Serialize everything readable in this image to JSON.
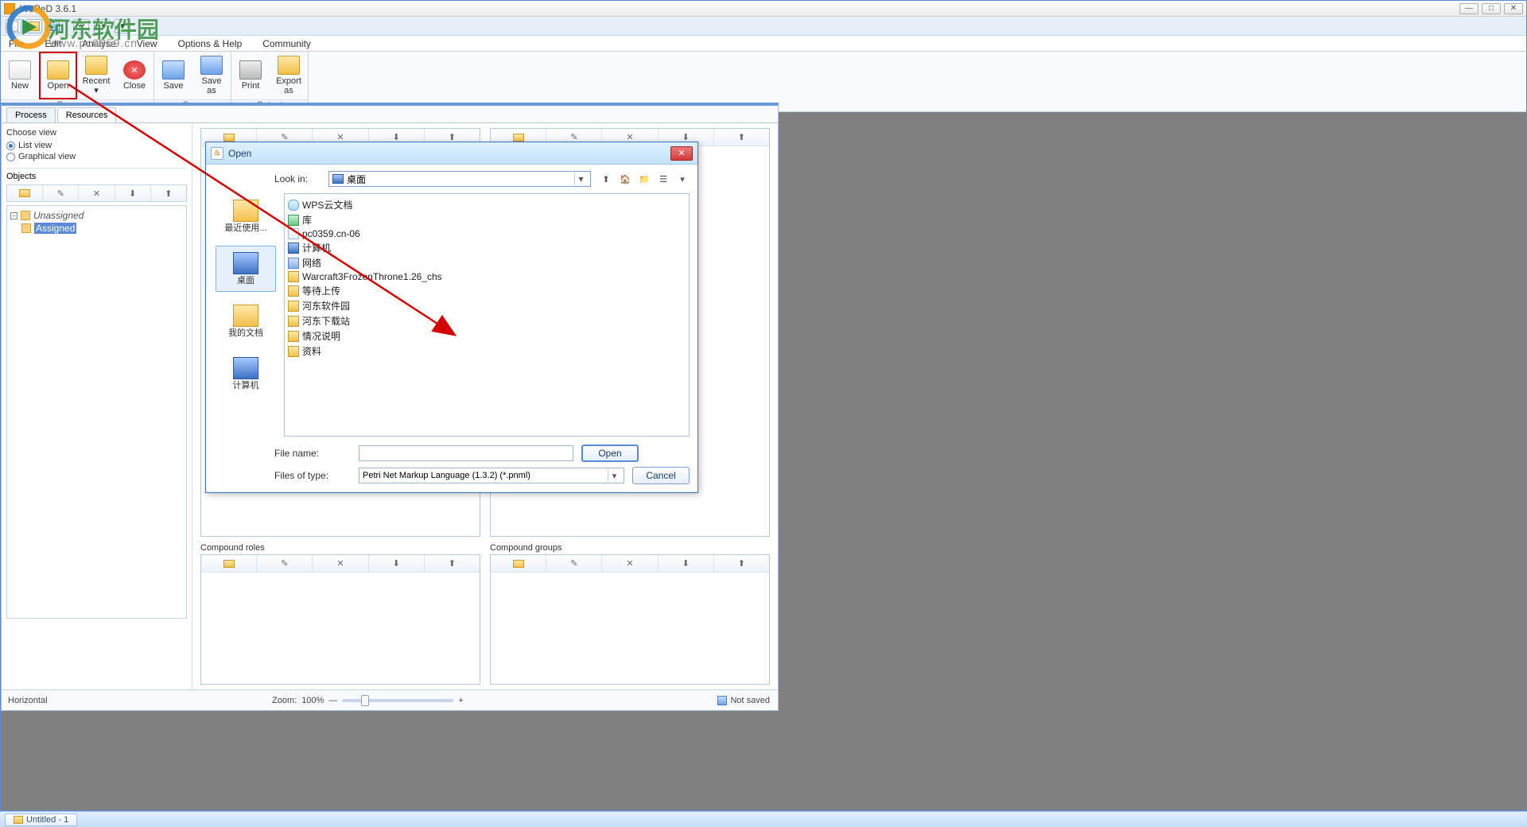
{
  "app": {
    "title": "WoPeD 3.6.1"
  },
  "menu": {
    "file": "File",
    "edit": "Edit",
    "analyse": "Analyse",
    "view": "View",
    "options": "Options & Help",
    "community": "Community"
  },
  "ribbon": {
    "document": {
      "label": "Document",
      "new": "New",
      "open": "Open",
      "recent": "Recent\n▾",
      "close": "Close"
    },
    "save": {
      "label": "Save",
      "save": "Save",
      "saveas": "Save\nas"
    },
    "output": {
      "label": "Output",
      "print": "Print",
      "export": "Export\nas"
    }
  },
  "tabs": {
    "process": "Process",
    "resources": "Resources"
  },
  "chooseview": {
    "title": "Choose view",
    "list": "List view",
    "graphical": "Graphical view"
  },
  "objects": {
    "title": "Objects",
    "unassigned": "Unassigned",
    "assigned": "Assigned"
  },
  "compound": {
    "roles": "Compound roles",
    "groups": "Compound groups"
  },
  "status": {
    "horizontal": "Horizontal",
    "zoomlabel": "Zoom:",
    "zoomval": "100%",
    "notsaved": "Not saved"
  },
  "dialog": {
    "title": "Open",
    "lookin": "Look in:",
    "lookin_val": "桌面",
    "places": {
      "recent": "最近使用...",
      "desktop": "桌面",
      "mydocs": "我的文档",
      "computer": "计算机"
    },
    "files": [
      {
        "icon": "cloud",
        "name": "WPS云文档"
      },
      {
        "icon": "lib",
        "name": "库"
      },
      {
        "icon": "doc",
        "name": "pc0359.cn-06"
      },
      {
        "icon": "monitor",
        "name": "计算机"
      },
      {
        "icon": "net",
        "name": "网络"
      },
      {
        "icon": "folder",
        "name": "Warcraft3FrozenThrone1.26_chs"
      },
      {
        "icon": "folder",
        "name": "等待上传"
      },
      {
        "icon": "folder",
        "name": "河东软件园"
      },
      {
        "icon": "folder",
        "name": "河东下载站"
      },
      {
        "icon": "folder",
        "name": "情况说明"
      },
      {
        "icon": "folder",
        "name": "资料"
      }
    ],
    "filename_lbl": "File name:",
    "filename_val": "",
    "filesoftype_lbl": "Files of type:",
    "filesoftype_val": "Petri Net Markup Language (1.3.2) (*.pnml)",
    "open_btn": "Open",
    "cancel_btn": "Cancel"
  },
  "taskbar": {
    "doc": "Untitled - 1"
  },
  "watermark": {
    "text": "河东软件园",
    "url": "www.pc0359.cn"
  }
}
